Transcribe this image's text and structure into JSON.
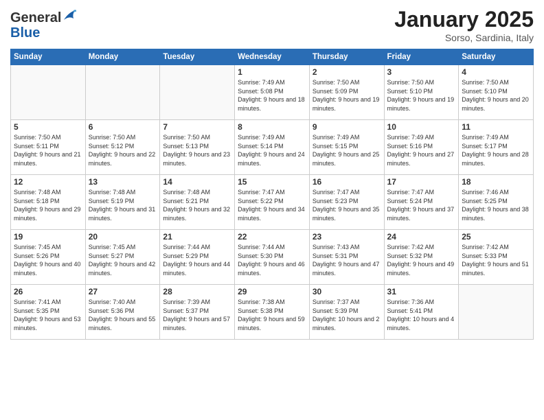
{
  "logo": {
    "general": "General",
    "blue": "Blue"
  },
  "header": {
    "month": "January 2025",
    "location": "Sorso, Sardinia, Italy"
  },
  "days_of_week": [
    "Sunday",
    "Monday",
    "Tuesday",
    "Wednesday",
    "Thursday",
    "Friday",
    "Saturday"
  ],
  "weeks": [
    [
      {
        "day": "",
        "info": ""
      },
      {
        "day": "",
        "info": ""
      },
      {
        "day": "",
        "info": ""
      },
      {
        "day": "1",
        "info": "Sunrise: 7:49 AM\nSunset: 5:08 PM\nDaylight: 9 hours\nand 18 minutes."
      },
      {
        "day": "2",
        "info": "Sunrise: 7:50 AM\nSunset: 5:09 PM\nDaylight: 9 hours\nand 19 minutes."
      },
      {
        "day": "3",
        "info": "Sunrise: 7:50 AM\nSunset: 5:10 PM\nDaylight: 9 hours\nand 19 minutes."
      },
      {
        "day": "4",
        "info": "Sunrise: 7:50 AM\nSunset: 5:10 PM\nDaylight: 9 hours\nand 20 minutes."
      }
    ],
    [
      {
        "day": "5",
        "info": "Sunrise: 7:50 AM\nSunset: 5:11 PM\nDaylight: 9 hours\nand 21 minutes."
      },
      {
        "day": "6",
        "info": "Sunrise: 7:50 AM\nSunset: 5:12 PM\nDaylight: 9 hours\nand 22 minutes."
      },
      {
        "day": "7",
        "info": "Sunrise: 7:50 AM\nSunset: 5:13 PM\nDaylight: 9 hours\nand 23 minutes."
      },
      {
        "day": "8",
        "info": "Sunrise: 7:49 AM\nSunset: 5:14 PM\nDaylight: 9 hours\nand 24 minutes."
      },
      {
        "day": "9",
        "info": "Sunrise: 7:49 AM\nSunset: 5:15 PM\nDaylight: 9 hours\nand 25 minutes."
      },
      {
        "day": "10",
        "info": "Sunrise: 7:49 AM\nSunset: 5:16 PM\nDaylight: 9 hours\nand 27 minutes."
      },
      {
        "day": "11",
        "info": "Sunrise: 7:49 AM\nSunset: 5:17 PM\nDaylight: 9 hours\nand 28 minutes."
      }
    ],
    [
      {
        "day": "12",
        "info": "Sunrise: 7:48 AM\nSunset: 5:18 PM\nDaylight: 9 hours\nand 29 minutes."
      },
      {
        "day": "13",
        "info": "Sunrise: 7:48 AM\nSunset: 5:19 PM\nDaylight: 9 hours\nand 31 minutes."
      },
      {
        "day": "14",
        "info": "Sunrise: 7:48 AM\nSunset: 5:21 PM\nDaylight: 9 hours\nand 32 minutes."
      },
      {
        "day": "15",
        "info": "Sunrise: 7:47 AM\nSunset: 5:22 PM\nDaylight: 9 hours\nand 34 minutes."
      },
      {
        "day": "16",
        "info": "Sunrise: 7:47 AM\nSunset: 5:23 PM\nDaylight: 9 hours\nand 35 minutes."
      },
      {
        "day": "17",
        "info": "Sunrise: 7:47 AM\nSunset: 5:24 PM\nDaylight: 9 hours\nand 37 minutes."
      },
      {
        "day": "18",
        "info": "Sunrise: 7:46 AM\nSunset: 5:25 PM\nDaylight: 9 hours\nand 38 minutes."
      }
    ],
    [
      {
        "day": "19",
        "info": "Sunrise: 7:45 AM\nSunset: 5:26 PM\nDaylight: 9 hours\nand 40 minutes."
      },
      {
        "day": "20",
        "info": "Sunrise: 7:45 AM\nSunset: 5:27 PM\nDaylight: 9 hours\nand 42 minutes."
      },
      {
        "day": "21",
        "info": "Sunrise: 7:44 AM\nSunset: 5:29 PM\nDaylight: 9 hours\nand 44 minutes."
      },
      {
        "day": "22",
        "info": "Sunrise: 7:44 AM\nSunset: 5:30 PM\nDaylight: 9 hours\nand 46 minutes."
      },
      {
        "day": "23",
        "info": "Sunrise: 7:43 AM\nSunset: 5:31 PM\nDaylight: 9 hours\nand 47 minutes."
      },
      {
        "day": "24",
        "info": "Sunrise: 7:42 AM\nSunset: 5:32 PM\nDaylight: 9 hours\nand 49 minutes."
      },
      {
        "day": "25",
        "info": "Sunrise: 7:42 AM\nSunset: 5:33 PM\nDaylight: 9 hours\nand 51 minutes."
      }
    ],
    [
      {
        "day": "26",
        "info": "Sunrise: 7:41 AM\nSunset: 5:35 PM\nDaylight: 9 hours\nand 53 minutes."
      },
      {
        "day": "27",
        "info": "Sunrise: 7:40 AM\nSunset: 5:36 PM\nDaylight: 9 hours\nand 55 minutes."
      },
      {
        "day": "28",
        "info": "Sunrise: 7:39 AM\nSunset: 5:37 PM\nDaylight: 9 hours\nand 57 minutes."
      },
      {
        "day": "29",
        "info": "Sunrise: 7:38 AM\nSunset: 5:38 PM\nDaylight: 9 hours\nand 59 minutes."
      },
      {
        "day": "30",
        "info": "Sunrise: 7:37 AM\nSunset: 5:39 PM\nDaylight: 10 hours\nand 2 minutes."
      },
      {
        "day": "31",
        "info": "Sunrise: 7:36 AM\nSunset: 5:41 PM\nDaylight: 10 hours\nand 4 minutes."
      },
      {
        "day": "",
        "info": ""
      }
    ]
  ]
}
